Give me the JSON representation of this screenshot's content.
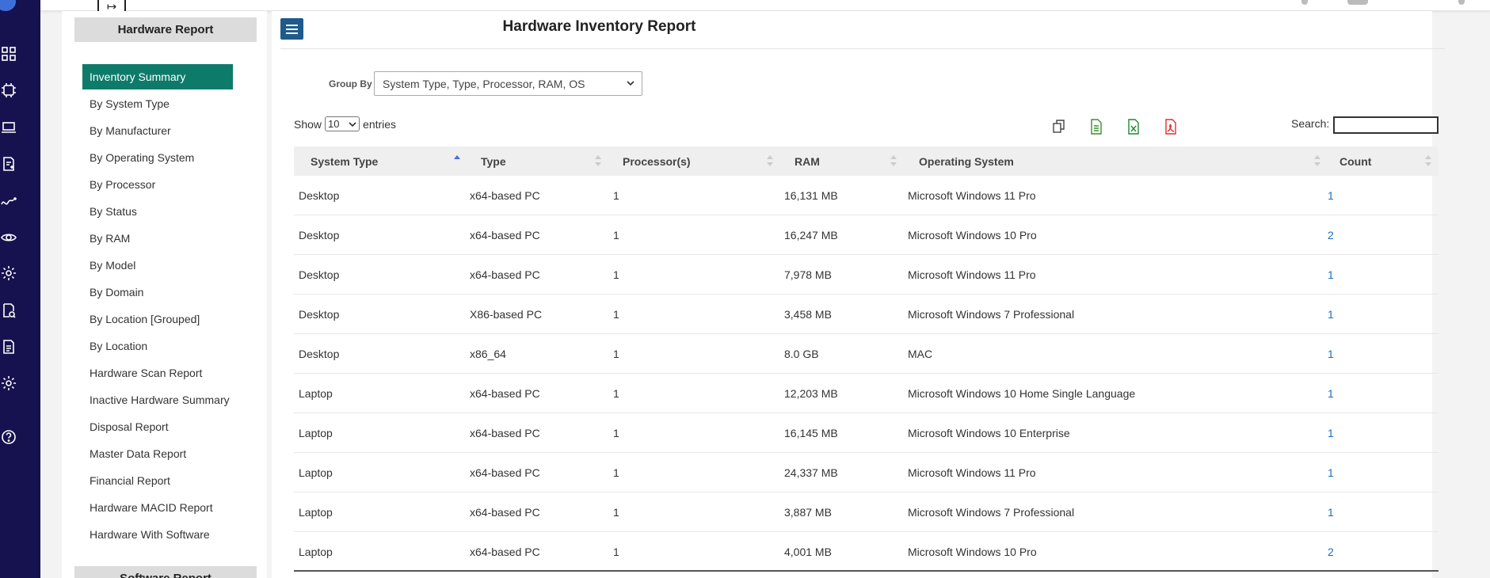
{
  "rail": {
    "icons": [
      "dashboard-icon",
      "chip-icon",
      "laptop-icon",
      "report-add-icon",
      "trend-icon",
      "eye-icon",
      "gear-icon",
      "search-report-icon",
      "document-icon",
      "settings-icon",
      "help-icon"
    ]
  },
  "topbar": {
    "collapse_glyph": "↦"
  },
  "sidebar": {
    "heading": "Hardware Report",
    "items": [
      {
        "label": "Inventory Summary",
        "active": true
      },
      {
        "label": "By System Type"
      },
      {
        "label": "By Manufacturer"
      },
      {
        "label": "By Operating System"
      },
      {
        "label": "By Processor"
      },
      {
        "label": "By Status"
      },
      {
        "label": "By RAM"
      },
      {
        "label": "By Model"
      },
      {
        "label": "By Domain"
      },
      {
        "label": "By Location [Grouped]"
      },
      {
        "label": "By Location"
      },
      {
        "label": "Hardware Scan Report"
      },
      {
        "label": "Inactive Hardware Summary"
      },
      {
        "label": "Disposal Report"
      },
      {
        "label": "Master Data Report"
      },
      {
        "label": "Financial Report"
      },
      {
        "label": "Hardware MACID Report"
      },
      {
        "label": "Hardware With Software"
      }
    ],
    "next_heading": "Software Report"
  },
  "main": {
    "title": "Hardware Inventory Report",
    "group_by_label": "Group By",
    "group_by_value": "System Type, Type, Processor, RAM, OS",
    "show_label": "Show",
    "show_value": "10",
    "entries_label": "entries",
    "search_label": "Search:",
    "export_icons": [
      {
        "name": "copy-icon",
        "color": "#444444"
      },
      {
        "name": "csv-icon",
        "color": "#3a8f2a"
      },
      {
        "name": "excel-icon",
        "color": "#1e8a2e"
      },
      {
        "name": "pdf-icon",
        "color": "#e0302a"
      }
    ]
  },
  "table": {
    "columns": [
      "System Type",
      "Type",
      "Processor(s)",
      "RAM",
      "Operating System",
      "Count"
    ],
    "rows": [
      [
        "Desktop",
        "x64-based PC",
        "1",
        "16,131 MB",
        "Microsoft Windows 11 Pro",
        "1"
      ],
      [
        "Desktop",
        "x64-based PC",
        "1",
        "16,247 MB",
        "Microsoft Windows 10 Pro",
        "2"
      ],
      [
        "Desktop",
        "x64-based PC",
        "1",
        "7,978 MB",
        "Microsoft Windows 11 Pro",
        "1"
      ],
      [
        "Desktop",
        "X86-based PC",
        "1",
        "3,458 MB",
        "Microsoft Windows 7 Professional",
        "1"
      ],
      [
        "Desktop",
        "x86_64",
        "1",
        "8.0 GB",
        "MAC",
        "1"
      ],
      [
        "Laptop",
        "x64-based PC",
        "1",
        "12,203 MB",
        "Microsoft Windows 10 Home Single Language",
        "1"
      ],
      [
        "Laptop",
        "x64-based PC",
        "1",
        "16,145 MB",
        "Microsoft Windows 10 Enterprise",
        "1"
      ],
      [
        "Laptop",
        "x64-based PC",
        "1",
        "24,337 MB",
        "Microsoft Windows 11 Pro",
        "1"
      ],
      [
        "Laptop",
        "x64-based PC",
        "1",
        "3,887 MB",
        "Microsoft Windows 7 Professional",
        "1"
      ],
      [
        "Laptop",
        "x64-based PC",
        "1",
        "4,001 MB",
        "Microsoft Windows 10 Pro",
        "2"
      ]
    ]
  },
  "colors": {
    "rail": "#16124f",
    "active_item": "#0e7b6a",
    "hamburger": "#1f5a8a",
    "link": "#1a6fc4"
  }
}
